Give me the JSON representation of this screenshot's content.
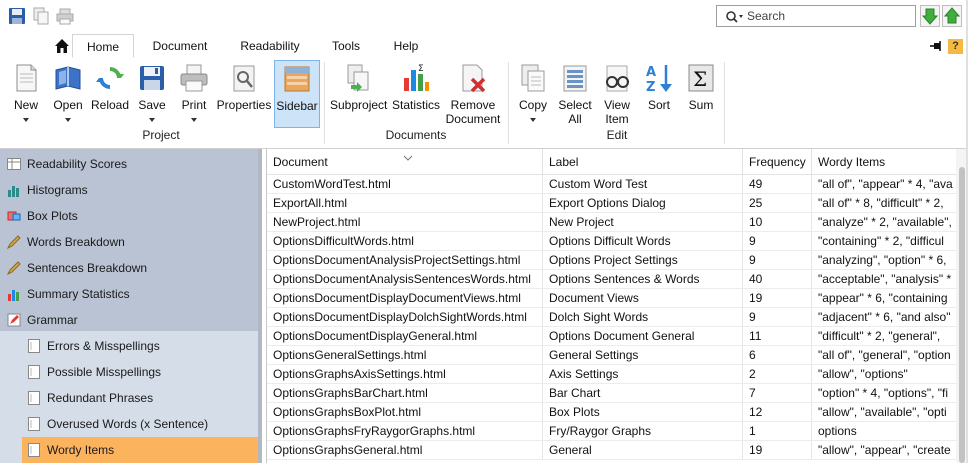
{
  "search": {
    "placeholder": "Search"
  },
  "tabs": [
    "Home",
    "Document",
    "Readability",
    "Tools",
    "Help"
  ],
  "help_label": "?",
  "ribbon": {
    "groups": [
      "Project",
      "Documents",
      "Edit"
    ],
    "buttons": {
      "new": "New",
      "open": "Open",
      "reload": "Reload",
      "save": "Save",
      "print": "Print",
      "properties": "Properties",
      "sidebar": "Sidebar",
      "subproject": "Subproject",
      "statistics": "Statistics",
      "remove_document_1": "Remove",
      "remove_document_2": "Document",
      "copy": "Copy",
      "select_all_1": "Select",
      "select_all_2": "All",
      "view_item_1": "View",
      "view_item_2": "Item",
      "sort": "Sort",
      "sum": "Sum"
    }
  },
  "sidebar": {
    "items": [
      "Readability Scores",
      "Histograms",
      "Box Plots",
      "Words Breakdown",
      "Sentences Breakdown",
      "Summary Statistics",
      "Grammar"
    ],
    "grammar_items": [
      "Errors & Misspellings",
      "Possible Misspellings",
      "Redundant Phrases",
      "Overused Words (x Sentence)",
      "Wordy Items"
    ],
    "selected": "Wordy Items"
  },
  "table": {
    "columns": [
      "Document",
      "Label",
      "Frequency",
      "Wordy Items"
    ],
    "rows": [
      [
        "CustomWordTest.html",
        "Custom Word Test",
        "49",
        "\"all of\", \"appear\" * 4, \"ava"
      ],
      [
        "ExportAll.html",
        "Export Options Dialog",
        "25",
        "\"all of\" * 8, \"difficult\" * 2,"
      ],
      [
        "NewProject.html",
        "New Project",
        "10",
        "\"analyze\" * 2, \"available\","
      ],
      [
        "OptionsDifficultWords.html",
        "Options Difficult Words",
        "9",
        "\"containing\" * 2, \"difficul"
      ],
      [
        "OptionsDocumentAnalysisProjectSettings.html",
        "Options Project Settings",
        "9",
        "\"analyzing\", \"option\" * 6,"
      ],
      [
        "OptionsDocumentAnalysisSentencesWords.html",
        "Options Sentences & Words",
        "40",
        "\"acceptable\", \"analysis\" *"
      ],
      [
        "OptionsDocumentDisplayDocumentViews.html",
        "Document Views",
        "19",
        "\"appear\" * 6, \"containing"
      ],
      [
        "OptionsDocumentDisplayDolchSightWords.html",
        "Dolch Sight Words",
        "9",
        "\"adjacent\" * 6, \"and also\""
      ],
      [
        "OptionsDocumentDisplayGeneral.html",
        "Options Document General",
        "11",
        "\"difficult\" * 2, \"general\","
      ],
      [
        "OptionsGeneralSettings.html",
        "General Settings",
        "6",
        "\"all of\", \"general\", \"option"
      ],
      [
        "OptionsGraphsAxisSettings.html",
        "Axis Settings",
        "2",
        "\"allow\", \"options\""
      ],
      [
        "OptionsGraphsBarChart.html",
        "Bar Chart",
        "7",
        "\"option\" * 4, \"options\", \"fi"
      ],
      [
        "OptionsGraphsBoxPlot.html",
        "Box Plots",
        "12",
        "\"allow\", \"available\", \"opti"
      ],
      [
        "OptionsGraphsFryRaygorGraphs.html",
        "Fry/Raygor Graphs",
        "1",
        "options"
      ],
      [
        "OptionsGraphsGeneral.html",
        "General",
        "19",
        "\"allow\", \"appear\", \"create"
      ]
    ]
  }
}
